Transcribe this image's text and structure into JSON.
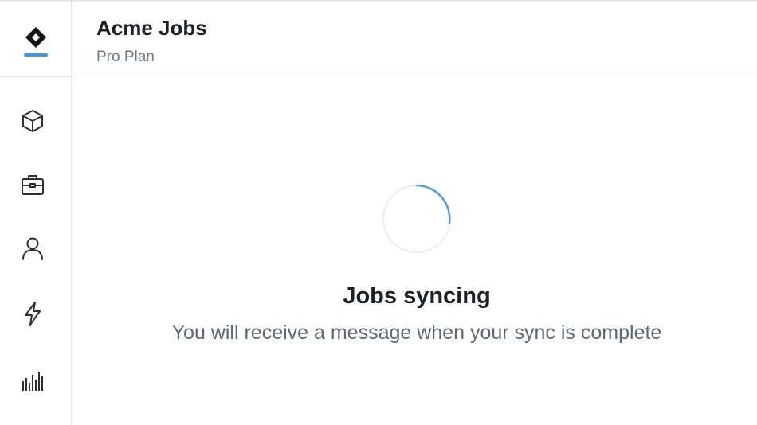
{
  "header": {
    "title": "Acme Jobs",
    "plan": "Pro Plan"
  },
  "sidebar": {
    "logo_icon": "diamond-logo-icon",
    "items": [
      {
        "icon": "cube-icon"
      },
      {
        "icon": "briefcase-icon"
      },
      {
        "icon": "user-icon"
      },
      {
        "icon": "lightning-icon"
      },
      {
        "icon": "bar-chart-icon"
      }
    ]
  },
  "status": {
    "title": "Jobs syncing",
    "message": "You will receive a message when your sync is complete"
  },
  "colors": {
    "accent": "#3d97e8",
    "text_primary": "#1d2126",
    "text_secondary": "#5d6878",
    "border": "#e3e4e7"
  }
}
